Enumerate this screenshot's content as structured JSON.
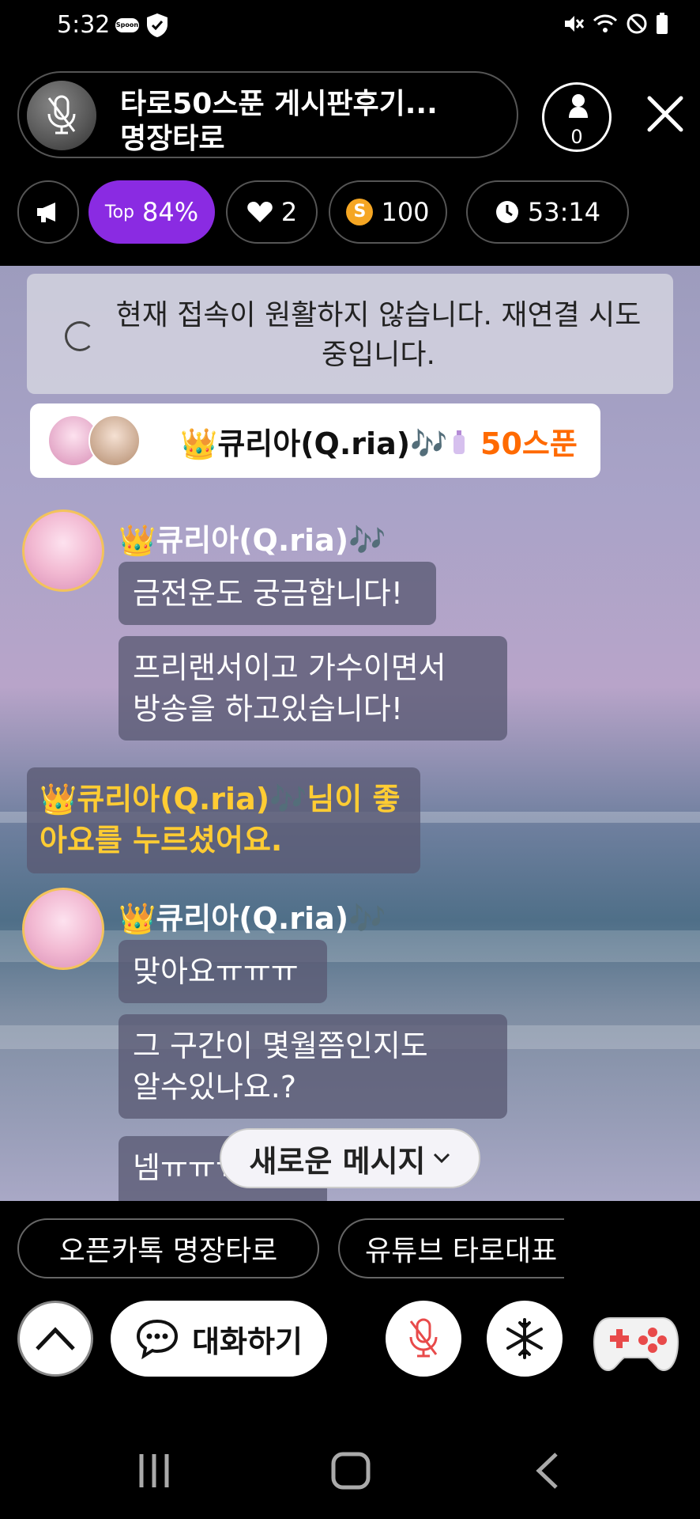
{
  "status_bar": {
    "time": "5:32",
    "app_badge": "Spoon"
  },
  "header": {
    "title_line1": "타로50스푼 게시판후기...",
    "title_line2": "명장타로",
    "listener_count": "0"
  },
  "stats": {
    "top_label": "Top",
    "top_percent": "84%",
    "likes": "2",
    "spoons": "100",
    "coin_symbol": "S",
    "elapsed": "53:14"
  },
  "reconnect_banner": {
    "text": "현재 접속이 원활하지 않습니다. 재연결 시도 중입니다."
  },
  "gift_banner": {
    "user": "👑큐리아(Q.ria)🎶",
    "amount": "50스푼"
  },
  "messages": [
    {
      "user": "👑큐리아(Q.ria)🎶",
      "bubbles": [
        "금전운도 궁금합니다!",
        "프리랜서이고 가수이면서\n방송을 하고있습니다!"
      ]
    },
    {
      "user": "👑큐리아(Q.ria)🎶",
      "bubbles": [
        "맞아요ㅠㅠㅠ",
        "그 구간이 몇월쯤인지도\n알수있나요.?",
        "넴ㅠㅠㅠ"
      ]
    }
  ],
  "like_notice": "👑큐리아(Q.ria)🎶님이 좋아요를 누르셨어요.",
  "new_message_button": "새로운 메시지",
  "quick_replies": [
    "오픈카톡 명장타로",
    "유튜브 타로대표"
  ],
  "bottom": {
    "chat_label": "대화하기"
  },
  "colors": {
    "accent": "#8a2be2",
    "gift_amount": "#ff6a00",
    "like_notice": "#ffcc33"
  }
}
